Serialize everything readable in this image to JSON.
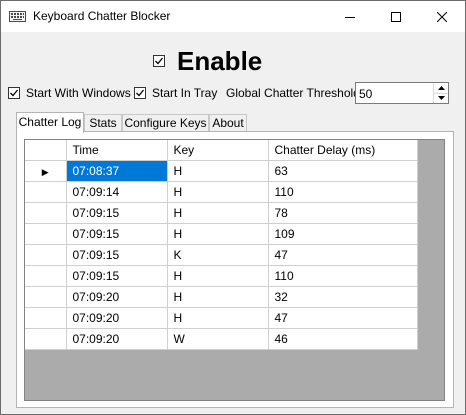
{
  "window": {
    "title": "Keyboard Chatter Blocker",
    "icon": "keyboard-icon",
    "controls": [
      "minimize-icon",
      "maximize-icon",
      "close-icon"
    ]
  },
  "enable": {
    "label": "Enable",
    "checked": true
  },
  "options": {
    "start_with_windows": {
      "label": "Start With Windows",
      "checked": true
    },
    "start_in_tray": {
      "label": "Start In Tray",
      "checked": true
    },
    "threshold": {
      "label": "Global Chatter Threshold:",
      "value": "50"
    }
  },
  "tabs": [
    {
      "label": "Chatter Log",
      "active": true
    },
    {
      "label": "Stats",
      "active": false
    },
    {
      "label": "Configure Keys",
      "active": false
    },
    {
      "label": "About",
      "active": false
    }
  ],
  "log": {
    "columns": [
      "Time",
      "Key",
      "Chatter Delay (ms)"
    ],
    "rows": [
      {
        "time": "07:08:37",
        "key": "H",
        "delay": "63",
        "selected": true
      },
      {
        "time": "07:09:14",
        "key": "H",
        "delay": "110"
      },
      {
        "time": "07:09:15",
        "key": "H",
        "delay": "78"
      },
      {
        "time": "07:09:15",
        "key": "H",
        "delay": "109"
      },
      {
        "time": "07:09:15",
        "key": "K",
        "delay": "47"
      },
      {
        "time": "07:09:15",
        "key": "H",
        "delay": "110"
      },
      {
        "time": "07:09:20",
        "key": "H",
        "delay": "32"
      },
      {
        "time": "07:09:20",
        "key": "H",
        "delay": "47"
      },
      {
        "time": "07:09:20",
        "key": "W",
        "delay": "46"
      }
    ]
  },
  "colors": {
    "selection": "#0078d7",
    "grid_background": "#ababab"
  }
}
